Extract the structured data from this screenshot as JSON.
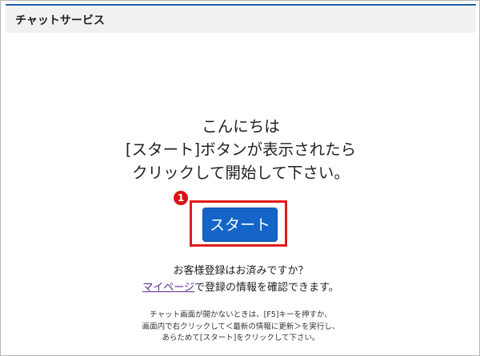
{
  "header": {
    "title": "チャットサービス"
  },
  "greeting": {
    "line1": "こんにちは",
    "line2": "[スタート]ボタンが表示されたら",
    "line3": "クリックして開始して下さい。"
  },
  "annotation": {
    "step_number": "1",
    "color": "#e11a1a"
  },
  "start_button": {
    "label": "スタート",
    "color": "#1565c9"
  },
  "member": {
    "question": "お客様登録はお済みですか？",
    "link_label": "マイページ",
    "line2_rest": "で登録の情報を確認できます。"
  },
  "note": {
    "line1": "チャット画面が開かないときは、[F5]キーを押すか、",
    "line2": "画面内で右クリックして＜最新の情報に更新＞を実行し、",
    "line3": "あらためて[スタート]をクリックして下さい。"
  }
}
